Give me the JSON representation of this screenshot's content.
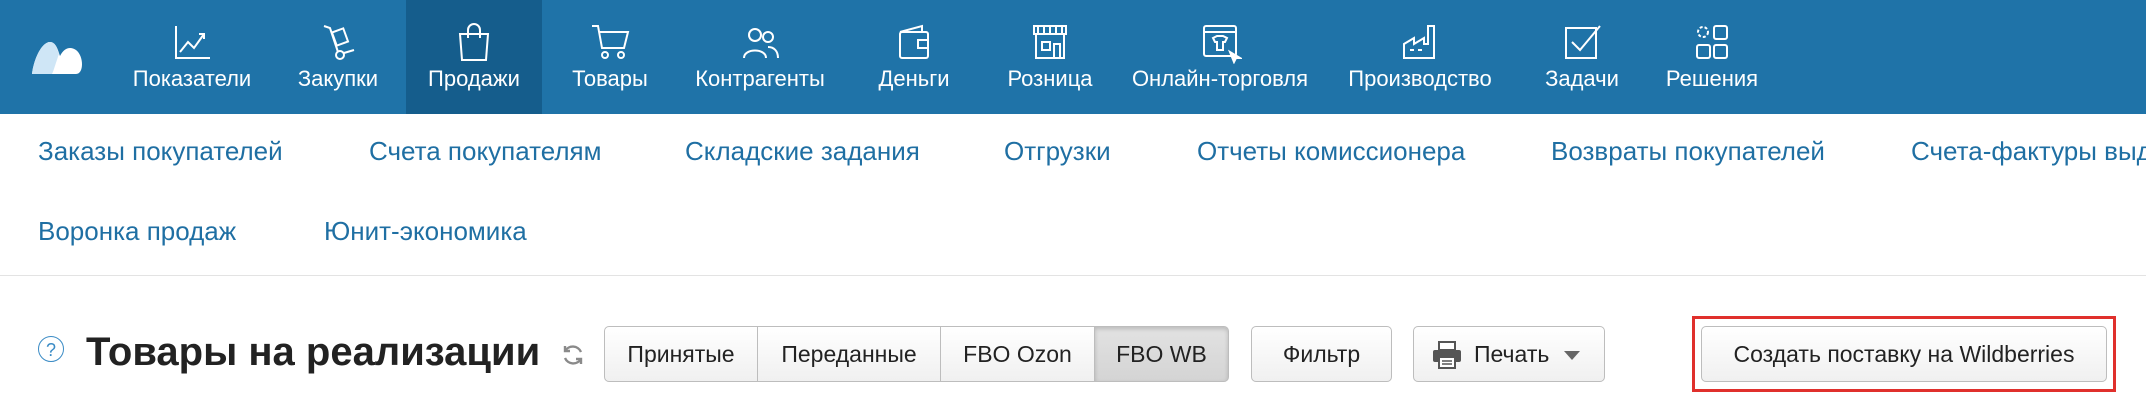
{
  "topnav": {
    "logo_icon": "moysklad-cloud-logo",
    "items": [
      {
        "label": "Показатели",
        "icon": "chart-line-icon"
      },
      {
        "label": "Закупки",
        "icon": "hand-truck-icon"
      },
      {
        "label": "Продажи",
        "icon": "shopping-bag-icon",
        "active": true
      },
      {
        "label": "Товары",
        "icon": "cart-icon"
      },
      {
        "label": "Контрагенты",
        "icon": "people-icon"
      },
      {
        "label": "Деньги",
        "icon": "wallet-icon"
      },
      {
        "label": "Розница",
        "icon": "store-icon"
      },
      {
        "label": "Онлайн-торговля",
        "icon": "online-shop-icon"
      },
      {
        "label": "Производство",
        "icon": "factory-icon"
      },
      {
        "label": "Задачи",
        "icon": "checkbox-icon"
      },
      {
        "label": "Решения",
        "icon": "apps-icon"
      }
    ]
  },
  "subnav": {
    "items": [
      "Заказы покупателей",
      "Счета покупателям",
      "Складские задания",
      "Отгрузки",
      "Отчеты комиссионера",
      "Возвраты покупателей",
      "Счета-фактуры выд",
      "Воронка продаж",
      "Юнит-экономика"
    ]
  },
  "page": {
    "help_symbol": "?",
    "title": "Товары на реализации"
  },
  "filters": {
    "segments": [
      "Принятые",
      "Переданные",
      "FBO Ozon",
      "FBO WB"
    ],
    "active": "FBO WB"
  },
  "toolbar": {
    "filter_label": "Фильтр",
    "print_label": "Печать",
    "create_label": "Создать поставку на Wildberries"
  },
  "colors": {
    "topbar": "#1f73a8",
    "topbar_active": "#155d8c",
    "link": "#1f6fa3",
    "highlight": "#e0302c"
  }
}
